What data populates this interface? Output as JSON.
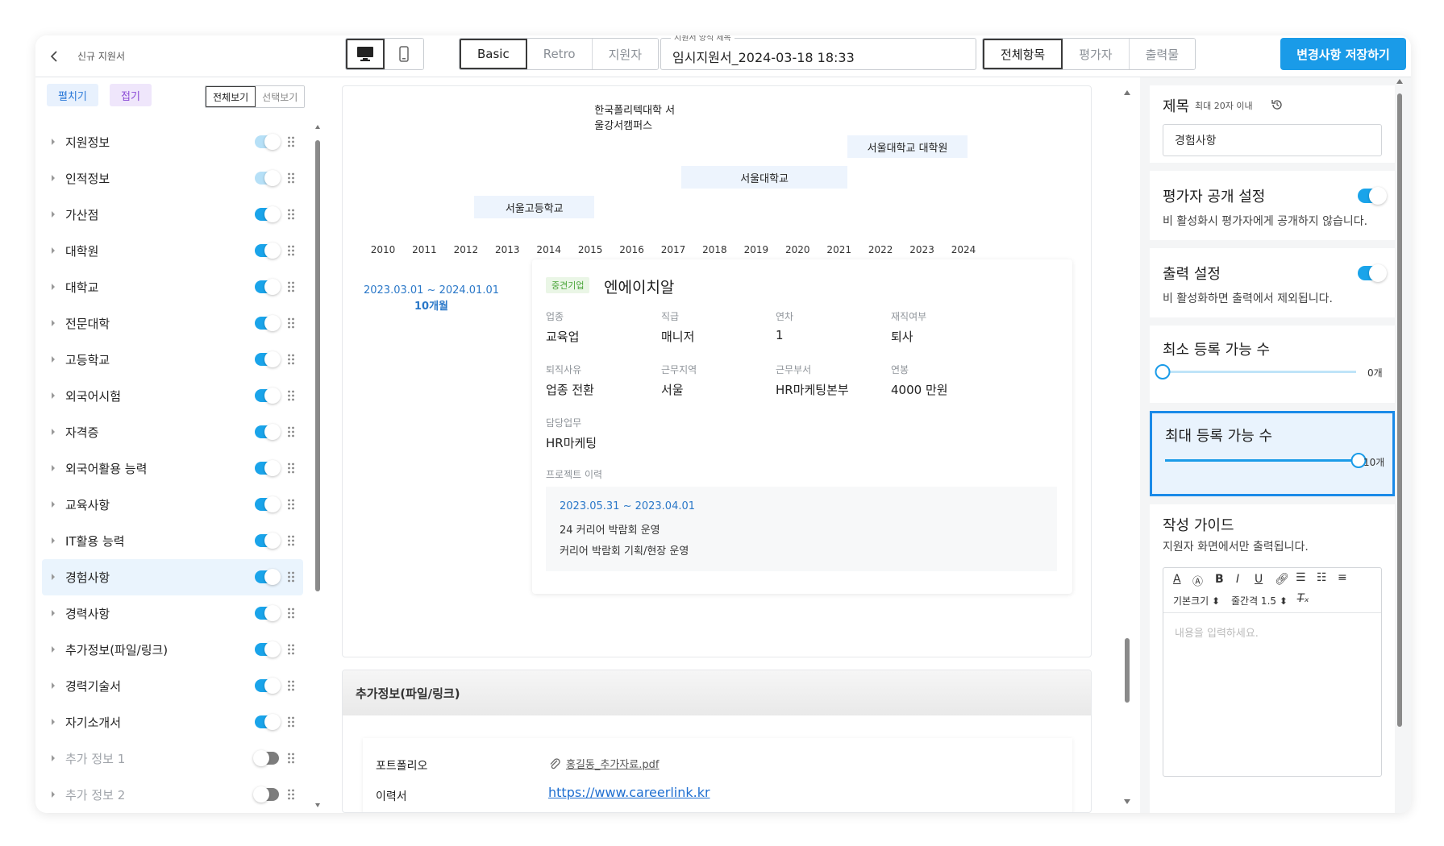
{
  "topbar": {
    "page_title": "신규 지원서",
    "layout_tabs": [
      {
        "label": "Basic",
        "active": true
      },
      {
        "label": "Retro",
        "active": false
      },
      {
        "label": "지원자",
        "active": false
      }
    ],
    "form_name": {
      "label": "지원서 양식 제목",
      "value": "임시지원서_2024-03-18 18:33"
    },
    "view_tabs": [
      {
        "label": "전체항목",
        "active": true
      },
      {
        "label": "평가자",
        "active": false
      },
      {
        "label": "출력물",
        "active": false
      }
    ],
    "save_label": "변경사항 저장하기"
  },
  "sidebar": {
    "expand_label": "펼치기",
    "collapse_label": "접기",
    "view_all_label": "전체보기",
    "view_selected_label": "선택보기",
    "items": [
      {
        "label": "지원정보",
        "state": "pale"
      },
      {
        "label": "인적정보",
        "state": "pale"
      },
      {
        "label": "가산점",
        "state": "on"
      },
      {
        "label": "대학원",
        "state": "on"
      },
      {
        "label": "대학교",
        "state": "on"
      },
      {
        "label": "전문대학",
        "state": "on"
      },
      {
        "label": "고등학교",
        "state": "on"
      },
      {
        "label": "외국어시험",
        "state": "on"
      },
      {
        "label": "자격증",
        "state": "on"
      },
      {
        "label": "외국어활용 능력",
        "state": "on"
      },
      {
        "label": "교육사항",
        "state": "on"
      },
      {
        "label": "IT활용 능력",
        "state": "on"
      },
      {
        "label": "경험사항",
        "state": "on"
      },
      {
        "label": "경력사항",
        "state": "on"
      },
      {
        "label": "추가정보(파일/링크)",
        "state": "on"
      },
      {
        "label": "경력기술서",
        "state": "on"
      },
      {
        "label": "자기소개서",
        "state": "on"
      },
      {
        "label": "추가 정보 1",
        "state": "off"
      },
      {
        "label": "추가 정보 2",
        "state": "off"
      }
    ]
  },
  "timeline": {
    "bars": [
      {
        "label": "한국폴리텍대학 서울강서캠퍼스",
        "start": 2015.1,
        "end": 2017.2,
        "row": 0
      },
      {
        "label": "서울대학교 대학원",
        "start": 2021.2,
        "end": 2024.1,
        "row": 1
      },
      {
        "label": "서울대학교",
        "start": 2017.2,
        "end": 2021.2,
        "row": 2
      },
      {
        "label": "서울고등학교",
        "start": 2012.2,
        "end": 2015.1,
        "row": 3
      }
    ],
    "years": [
      "2010",
      "2011",
      "2012",
      "2013",
      "2014",
      "2015",
      "2016",
      "2017",
      "2018",
      "2019",
      "2020",
      "2021",
      "2022",
      "2023",
      "2024"
    ]
  },
  "experience": {
    "period": "2023.03.01 ~ 2024.01.01",
    "duration": "10개월",
    "badge": "중견기업",
    "company": "엔에이치알",
    "fields": [
      {
        "label": "업종",
        "value": "교육업"
      },
      {
        "label": "직급",
        "value": "매니저"
      },
      {
        "label": "연차",
        "value": "1"
      },
      {
        "label": "재직여부",
        "value": "퇴사"
      },
      {
        "label": "퇴직사유",
        "value": "업종 전환"
      },
      {
        "label": "근무지역",
        "value": "서울"
      },
      {
        "label": "근무부서",
        "value": "HR마케팅본부"
      },
      {
        "label": "연봉",
        "value": "4000 만원"
      },
      {
        "label": "담당업무",
        "value": "HR마케팅"
      }
    ],
    "project_label": "프로젝트 이력",
    "project": {
      "date": "2023.05.31 ~ 2023.04.01",
      "title": "24 커리어 박람회 운영",
      "desc": "커리어 박람회 기획/현장 운영"
    }
  },
  "extra": {
    "header": "추가정보(파일/링크)",
    "portfolio_label": "포트폴리오",
    "portfolio_file": "홍길동_추가자료.pdf",
    "resume_label": "이력서",
    "resume_url": "https://www.careerlink.kr"
  },
  "settings": {
    "title_label": "제목",
    "title_hint": "최대 20자 이내",
    "title_value": "경험사항",
    "eval_title": "평가자 공개 설정",
    "eval_desc": "비 활성화시 평가자에게 공개하지 않습니다.",
    "print_title": "출력 설정",
    "print_desc": "비 활성화하면 출력에서 제외됩니다.",
    "min_title": "최소 등록 가능 수",
    "min_value": "0개",
    "min_fraction": 0,
    "max_title": "최대 등록 가능 수",
    "max_value": "10개",
    "max_fraction": 1,
    "guide_title": "작성 가이드",
    "guide_desc": "지원자 화면에서만 출력됩니다.",
    "editor_font_size": "기본크기",
    "editor_line_height": "줄간격 1.5",
    "editor_placeholder": "내용을 입력하세요."
  },
  "colors": {
    "accent": "#1a9be8",
    "toggle_on": "#1aa4ea",
    "selected_bg": "#eaf4fd",
    "timeline_bar": "#edf4fd"
  }
}
